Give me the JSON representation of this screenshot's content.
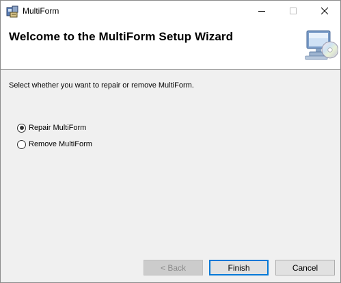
{
  "window": {
    "title": "MultiForm"
  },
  "caption_buttons": {
    "minimize_icon": "minimize-icon",
    "maximize_icon": "maximize-icon",
    "close_icon": "close-icon"
  },
  "header": {
    "title": "Welcome to the MultiForm Setup Wizard",
    "icon": "computer-cd-icon"
  },
  "body": {
    "instruction": "Select whether you want to repair or remove MultiForm.",
    "options": [
      {
        "label": "Repair MultiForm",
        "checked": true
      },
      {
        "label": "Remove MultiForm",
        "checked": false
      }
    ]
  },
  "footer": {
    "back_label": "< Back",
    "back_enabled": false,
    "finish_label": "Finish",
    "cancel_label": "Cancel"
  },
  "colors": {
    "window_bg": "#f0f0f0",
    "banner_bg": "#ffffff",
    "focus_accent": "#0078d7",
    "disabled_text": "#8a8a8a"
  }
}
